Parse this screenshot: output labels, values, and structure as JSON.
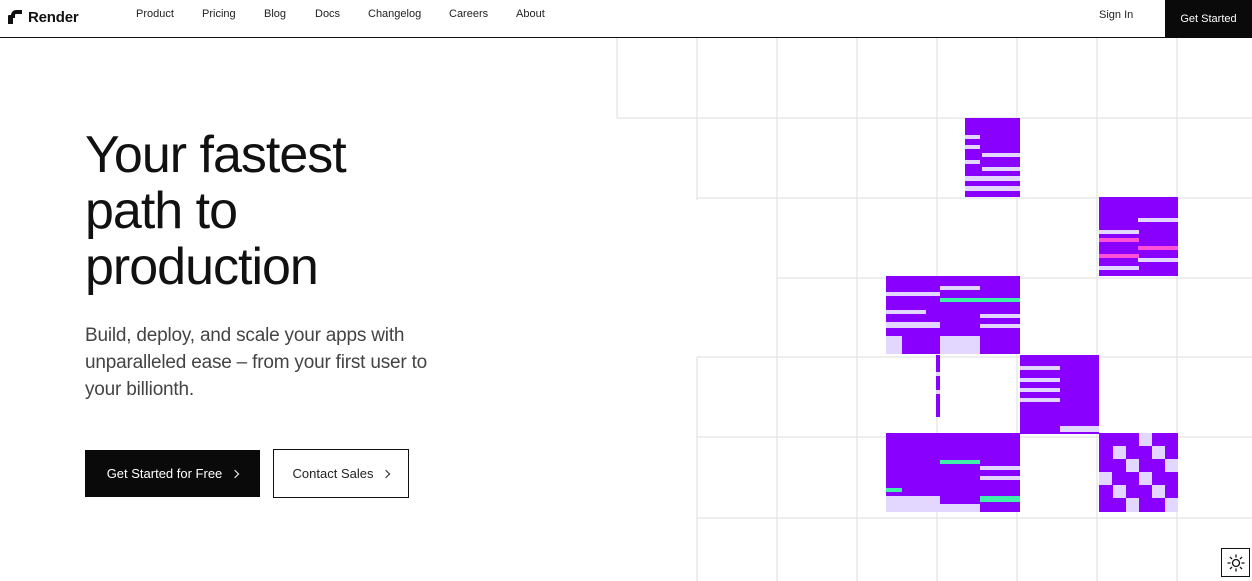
{
  "brand": {
    "name": "Render"
  },
  "nav": {
    "items": [
      "Product",
      "Pricing",
      "Blog",
      "Docs",
      "Changelog",
      "Careers",
      "About"
    ],
    "signin_label": "Sign In",
    "cta_label": "Get Started"
  },
  "hero": {
    "headline_lines": [
      "Your fastest",
      "path to",
      "production"
    ],
    "subheadline": "Build, deploy, and scale your apps with unparalleled ease – from your first user to your billionth.",
    "primary_button": "Get Started for Free",
    "secondary_button": "Contact Sales"
  },
  "theme_toggle": {
    "icon": "sun-icon"
  },
  "colors": {
    "accent_purple": "#8a00ff",
    "light_lavender": "#e3d6ff",
    "mint": "#3ef0a8",
    "pink": "#ff4fd8",
    "grid_line": "#e3e3e3"
  }
}
